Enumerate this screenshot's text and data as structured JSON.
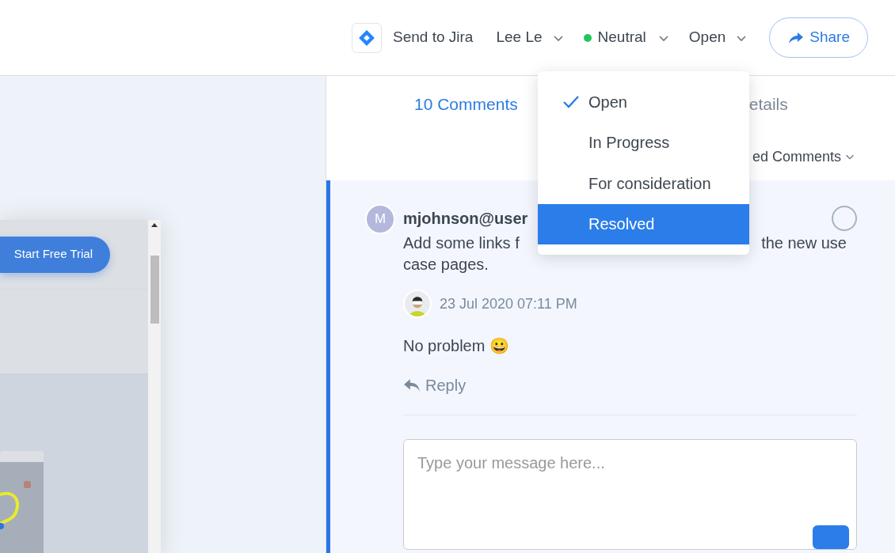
{
  "toolbar": {
    "jira_button": "Send to Jira",
    "assignee": "Lee Le",
    "sentiment": {
      "label": "Neutral",
      "color": "#22c55e"
    },
    "status": "Open",
    "share": "Share"
  },
  "preview": {
    "cta": "Start Free Trial"
  },
  "tabs": [
    {
      "label": "10 Comments",
      "selected": true
    },
    {
      "label": "etails",
      "selected": false
    }
  ],
  "filter": "ed Comments",
  "status_menu": [
    {
      "label": "Open",
      "checked": true,
      "selected": false
    },
    {
      "label": "In Progress",
      "checked": false,
      "selected": false
    },
    {
      "label": "For consideration",
      "checked": false,
      "selected": false
    },
    {
      "label": "Resolved",
      "checked": false,
      "selected": true
    }
  ],
  "comment": {
    "avatar_initial": "M",
    "author": "mjohnson@user",
    "resolved": false,
    "body_lines": [
      [
        "Add some links f",
        "the new use"
      ],
      [
        "case pages."
      ]
    ],
    "reply": {
      "time": "23 Jul 2020 07:11 PM",
      "text": "No problem 😀"
    }
  },
  "reply_action": "Reply",
  "composer": {
    "placeholder": "Type your message here..."
  }
}
